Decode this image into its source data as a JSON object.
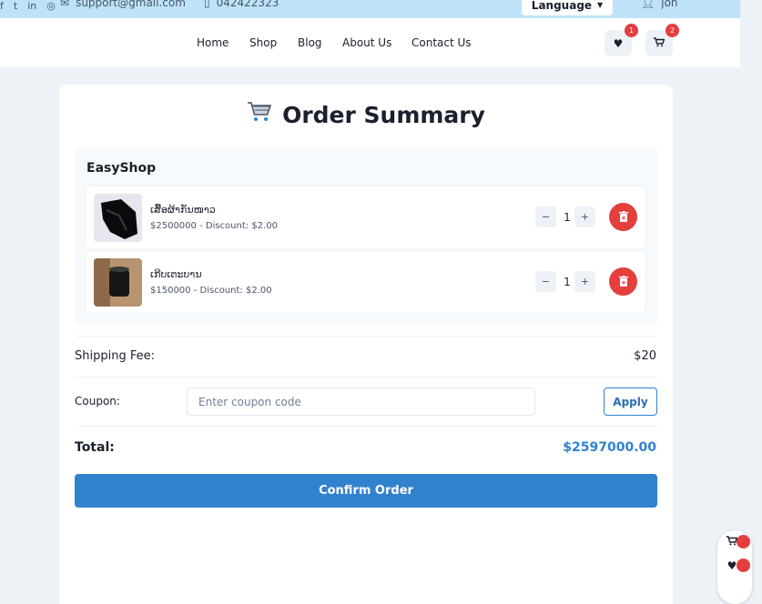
{
  "topbar": {
    "email": "support@gmail.com",
    "phone": "042422323",
    "language_label": "Language",
    "user_name": "jon",
    "social_icons": [
      "facebook-icon",
      "twitter-icon",
      "linkedin-icon",
      "github-icon"
    ]
  },
  "nav": {
    "links": [
      "Home",
      "Shop",
      "Blog",
      "About Us",
      "Contact Us"
    ],
    "wishlist_count": "1",
    "cart_count": "2"
  },
  "order": {
    "title": "Order Summary",
    "shop_name": "EasyShop",
    "items": [
      {
        "name": "ເສື້ອຜ້າກັນໜາວ",
        "price_line": "$2500000 - Discount: $2.00",
        "qty": "1",
        "image": "black-jacket-photo"
      },
      {
        "name": "ເກີບເຕະບານ",
        "price_line": "$150000 - Discount: $2.00",
        "qty": "1",
        "image": "black-speaker-photo"
      }
    ],
    "shipping_label": "Shipping Fee:",
    "shipping_value": "$20",
    "coupon_label": "Coupon:",
    "coupon_placeholder": "Enter coupon code",
    "apply_label": "Apply",
    "total_label": "Total:",
    "total_value": "$2597000.00",
    "confirm_label": "Confirm Order"
  },
  "colors": {
    "accent": "#3182ce",
    "danger": "#e53e3e",
    "topbar_bg": "#bee3f8",
    "page_bg": "#edf2f7"
  }
}
